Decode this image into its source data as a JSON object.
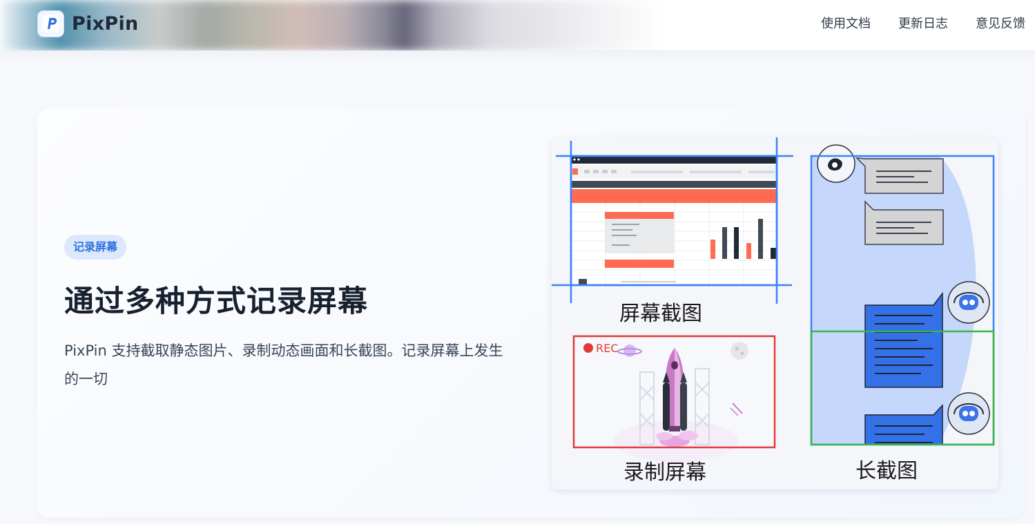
{
  "header": {
    "brand": "PixPin",
    "nav": [
      "使用文档",
      "更新日志",
      "意见反馈"
    ]
  },
  "feature": {
    "badge": "记录屏幕",
    "title": "通过多种方式记录屏幕",
    "description": "PixPin 支持截取静态图片、录制动态画面和长截图。记录屏幕上发生的一切"
  },
  "illustration": {
    "screenshot_caption": "屏幕截图",
    "record_caption": "录制屏幕",
    "long_caption": "长截图",
    "rec_label": "REC"
  },
  "colors": {
    "accent": "#2f6fe0",
    "badge_bg": "#dce8fb",
    "screenshot_frame": "#3b82f6",
    "record_frame": "#e03a3a",
    "long_frame_green": "#3ab54a"
  }
}
